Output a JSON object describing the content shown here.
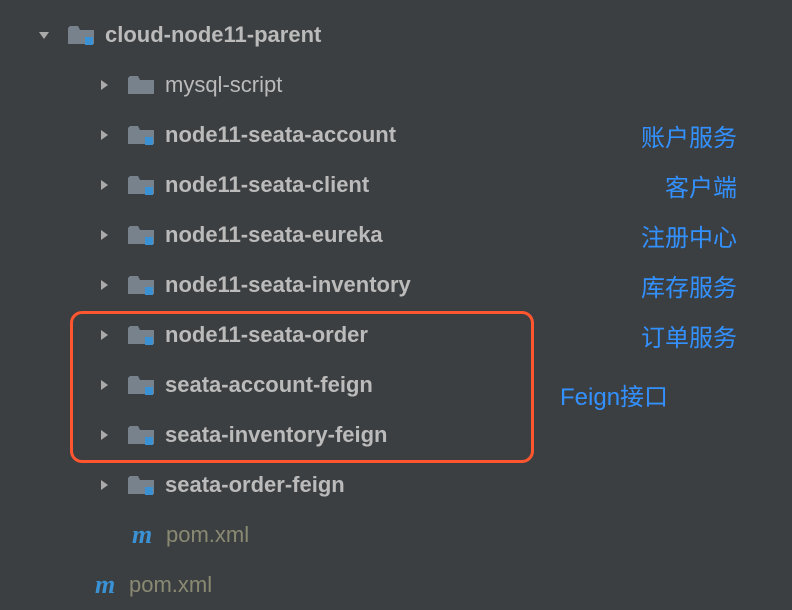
{
  "tree": {
    "root": {
      "name": "cloud-node11-parent",
      "children": [
        {
          "name": "mysql-script",
          "bold": false,
          "type": "folder",
          "annotation": ""
        },
        {
          "name": "node11-seata-account",
          "bold": true,
          "type": "module",
          "annotation": "账户服务"
        },
        {
          "name": "node11-seata-client",
          "bold": true,
          "type": "module",
          "annotation": "客户端"
        },
        {
          "name": "node11-seata-eureka",
          "bold": true,
          "type": "module",
          "annotation": "注册中心"
        },
        {
          "name": "node11-seata-inventory",
          "bold": true,
          "type": "module",
          "annotation": "库存服务"
        },
        {
          "name": "node11-seata-order",
          "bold": true,
          "type": "module",
          "annotation": "订单服务"
        },
        {
          "name": "seata-account-feign",
          "bold": true,
          "type": "module",
          "annotation": ""
        },
        {
          "name": "seata-inventory-feign",
          "bold": true,
          "type": "module",
          "annotation": ""
        },
        {
          "name": "seata-order-feign",
          "bold": true,
          "type": "module",
          "annotation": ""
        },
        {
          "name": "pom.xml",
          "bold": false,
          "type": "pom",
          "annotation": ""
        }
      ]
    },
    "rootPom": "pom.xml"
  },
  "feignLabel": "Feign接口"
}
